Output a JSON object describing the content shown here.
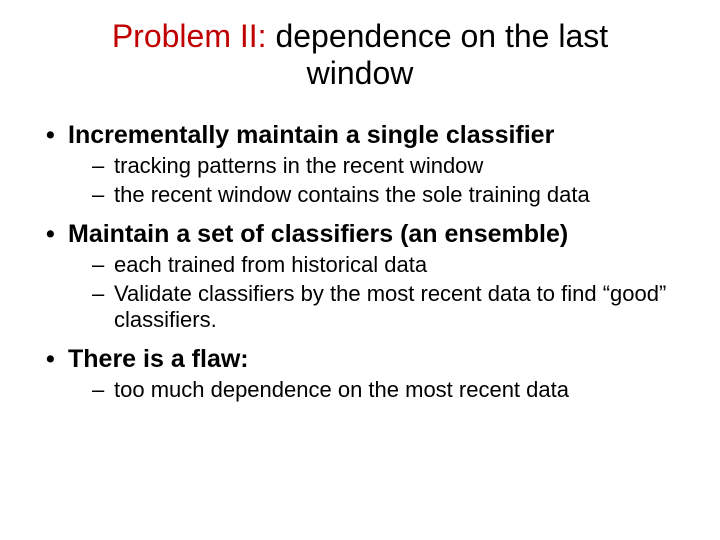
{
  "title": {
    "highlight": "Problem II:",
    "rest": " dependence on the last window"
  },
  "bullets": [
    {
      "text": "Incrementally maintain a single classifier",
      "sub": [
        "tracking patterns in the recent window",
        "the recent window contains the sole training data"
      ]
    },
    {
      "text": "Maintain a set of classifiers (an ensemble)",
      "sub": [
        "each trained from historical data",
        "Validate classifiers by the most recent data to find  “good” classifiers."
      ]
    },
    {
      "text": "There is a flaw:",
      "sub": [
        "too much dependence on the most recent data"
      ]
    }
  ]
}
